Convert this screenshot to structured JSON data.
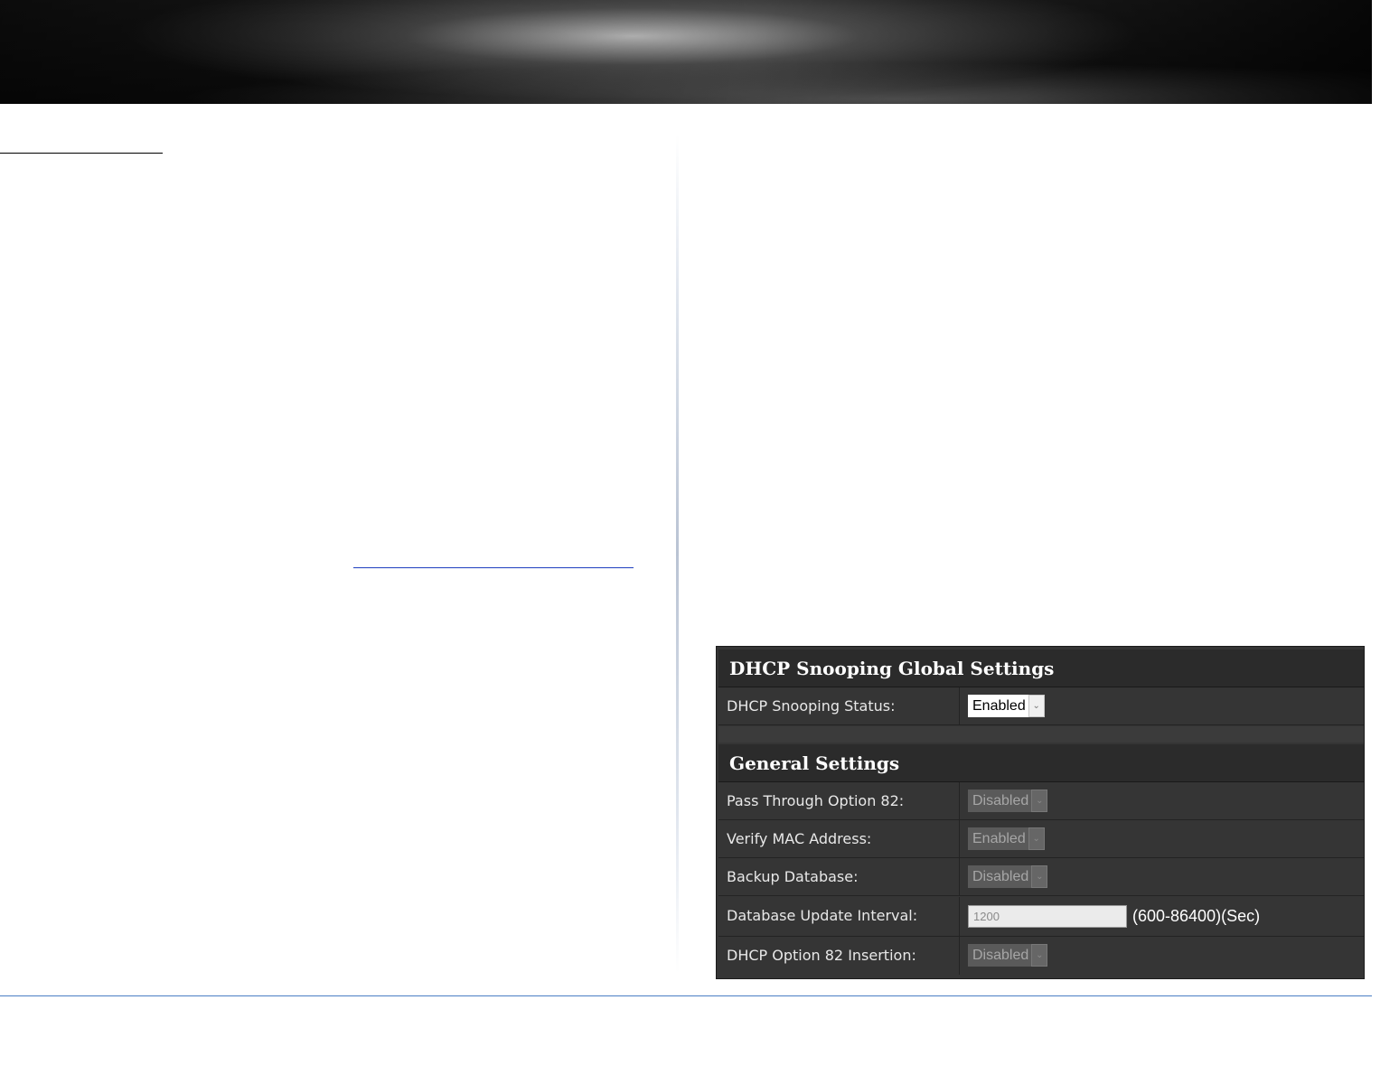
{
  "dhcp_panel": {
    "global_title": "DHCP Snooping Global Settings",
    "status_label": "DHCP Snooping Status:",
    "status_value": "Enabled",
    "general_title": "General Settings",
    "rows": [
      {
        "label": "Pass Through Option 82:",
        "value": "Disabled"
      },
      {
        "label": "Verify MAC Address:",
        "value": "Enabled"
      },
      {
        "label": "Backup Database:",
        "value": "Disabled"
      },
      {
        "label": "Database Update Interval:",
        "value": "1200",
        "hint": "(600-86400)(Sec)"
      },
      {
        "label": "DHCP Option 82 Insertion:",
        "value": "Disabled"
      }
    ]
  },
  "icons": {
    "dropdown": "chevron-down-icon"
  },
  "colors": {
    "panel_background": "#353535",
    "header_background": "#2b2b2b",
    "footer_line": "#4a7fc5"
  }
}
